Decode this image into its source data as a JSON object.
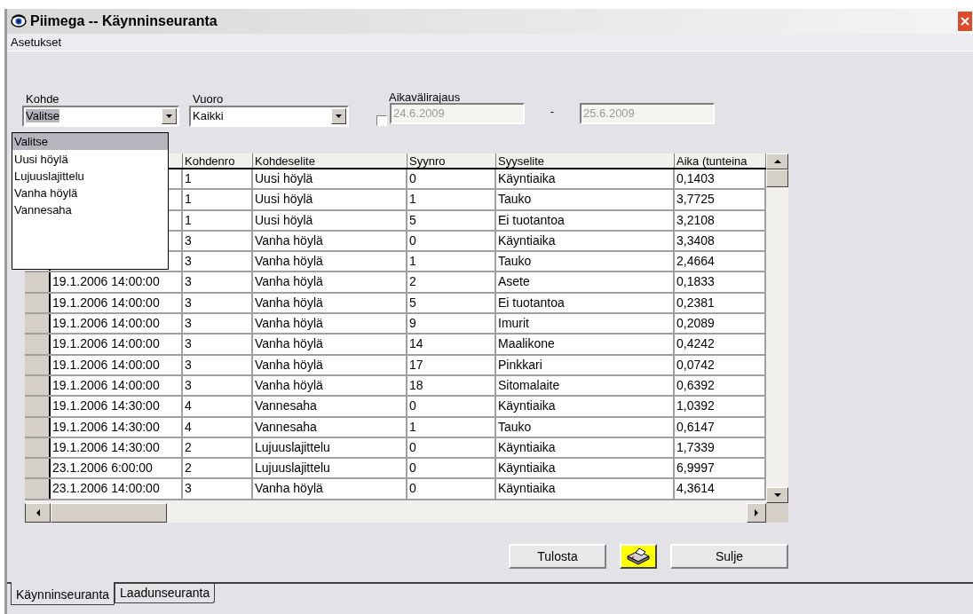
{
  "window": {
    "title": "Piimega -- Käynninseuranta"
  },
  "menu": [
    "Asetukset"
  ],
  "filters": {
    "kohde": {
      "label": "Kohde",
      "value": "Valitse",
      "expanded": true,
      "options": [
        {
          "label": "Valitse",
          "selected": true
        },
        {
          "label": "Uusi höylä",
          "selected": false
        },
        {
          "label": "Lujuuslajittelu",
          "selected": false
        },
        {
          "label": "Vanha höylä",
          "selected": false
        },
        {
          "label": "Vannesaha",
          "selected": false
        }
      ]
    },
    "vuoro": {
      "label": "Vuoro",
      "value": "Kaikki"
    },
    "aikavalirajaus": {
      "label": "Aikavälirajaus",
      "checked": false,
      "start": "24.6.2009",
      "separator": "-",
      "end": "25.6.2009",
      "disabled": true
    }
  },
  "table": {
    "columns": [
      "Kohdenro",
      "Kohdeselite",
      "Syynro",
      "Syyselite",
      "Aika (tunteina"
    ],
    "rows": [
      {
        "cells": [
          "1",
          "Uusi höylä",
          "0",
          "Käyntiaika",
          "0,1403"
        ]
      },
      {
        "cells": [
          "1",
          "Uusi höylä",
          "1",
          "Tauko",
          "3,7725"
        ]
      },
      {
        "cells": [
          "1",
          "Uusi höylä",
          "5",
          "Ei tuotantoa",
          "3,2108"
        ]
      },
      {
        "cells": [
          "3",
          "Vanha höylä",
          "0",
          "Käyntiaika",
          "3,3408"
        ]
      },
      {
        "cells": [
          "3",
          "Vanha höylä",
          "1",
          "Tauko",
          "2,4664"
        ]
      },
      {
        "column_1": "19.1.2006 14:00:00",
        "cells": [
          "3",
          "Vanha höylä",
          "2",
          "Asete",
          "0,1833"
        ]
      },
      {
        "column_1": "19.1.2006 14:00:00",
        "cells": [
          "3",
          "Vanha höylä",
          "5",
          "Ei tuotantoa",
          "0,2381"
        ]
      },
      {
        "column_1": "19.1.2006 14:00:00",
        "cells": [
          "3",
          "Vanha höylä",
          "9",
          "Imurit",
          "0,2089"
        ]
      },
      {
        "column_1": "19.1.2006 14:00:00",
        "cells": [
          "3",
          "Vanha höylä",
          "14",
          "Maalikone",
          "0,4242"
        ]
      },
      {
        "column_1": "19.1.2006 14:00:00",
        "cells": [
          "3",
          "Vanha höylä",
          "17",
          "Pinkkari",
          "0,0742"
        ]
      },
      {
        "column_1": "19.1.2006 14:00:00",
        "cells": [
          "3",
          "Vanha höylä",
          "18",
          "Sitomalaite",
          "0,6392"
        ]
      },
      {
        "column_1": "19.1.2006 14:30:00",
        "cells": [
          "4",
          "Vannesaha",
          "0",
          "Käyntiaika",
          "1,0392"
        ]
      },
      {
        "column_1": "19.1.2006 14:30:00",
        "cells": [
          "4",
          "Vannesaha",
          "1",
          "Tauko",
          "0,6147"
        ]
      },
      {
        "column_1": "19.1.2006 14:30:00",
        "cells": [
          "2",
          "Lujuuslajittelu",
          "0",
          "Käyntiaika",
          "1,7339"
        ]
      },
      {
        "column_1": "23.1.2006 6:00:00",
        "cells": [
          "2",
          "Lujuuslajittelu",
          "0",
          "Käyntiaika",
          "6,9997"
        ]
      },
      {
        "column_1": "23.1.2006 14:00:00",
        "cells": [
          "3",
          "Vanha höylä",
          "0",
          "Käyntiaika",
          "4,3614"
        ]
      }
    ]
  },
  "buttons": [
    {
      "kind": "text",
      "label": "Tulosta"
    },
    {
      "kind": "printer"
    },
    {
      "kind": "text",
      "label": "Sulje"
    }
  ],
  "tabs": [
    {
      "label": "Käynninseuranta",
      "selected": true
    },
    {
      "label": "Laadunseuranta",
      "selected": false
    }
  ]
}
